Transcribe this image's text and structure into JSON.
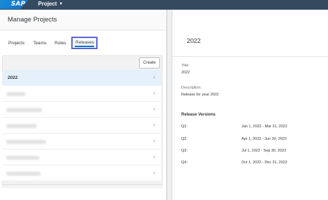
{
  "shell": {
    "logo_text": "SAP",
    "app_title": "Project"
  },
  "master": {
    "title": "Manage Projects",
    "tabs": [
      {
        "label": "Projects"
      },
      {
        "label": "Teams"
      },
      {
        "label": "Roles"
      },
      {
        "label": "Releases"
      }
    ],
    "create_label": "Create",
    "list": {
      "selected_label": "2022"
    }
  },
  "detail": {
    "title": "2022",
    "fields": {
      "title_label": "Title:",
      "title_value": "2022",
      "description_label": "Description:",
      "description_value": "Release for year 2022"
    },
    "versions_title": "Release Versions",
    "versions": [
      {
        "label": "Q1:",
        "range": "Jan 1, 2022 - Mar 31, 2022"
      },
      {
        "label": "Q2:",
        "range": "Apr 1, 2022 - Jun 30, 2022"
      },
      {
        "label": "Q3:",
        "range": "Jul 1, 2022 - Sep 30, 2022"
      },
      {
        "label": "Q4:",
        "range": "Oct 1, 2022 - Dec 31, 2022"
      }
    ]
  },
  "colors": {
    "shellbar": "#354a5f",
    "brand": "#0a6ed1",
    "highlight_border": "#5b63d6",
    "selected_row": "#e5f0fa"
  }
}
